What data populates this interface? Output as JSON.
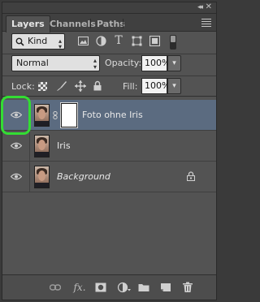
{
  "tabs": [
    {
      "label": "Layers",
      "active": true
    },
    {
      "label": "Channels",
      "active": false
    },
    {
      "label": "Paths",
      "active": false
    }
  ],
  "filter": {
    "kind_label": "Kind"
  },
  "blend": {
    "mode": "Normal",
    "opacity_label": "Opacity:",
    "opacity_value": "100%",
    "lock_label": "Lock:",
    "fill_label": "Fill:",
    "fill_value": "100%"
  },
  "layers": [
    {
      "name": "Foto ohne Iris",
      "visible": true,
      "selected": true,
      "has_mask": true
    },
    {
      "name": "Iris",
      "visible": true,
      "selected": false,
      "has_mask": false
    },
    {
      "name": "Background",
      "visible": true,
      "selected": false,
      "italic": true,
      "locked": true
    }
  ],
  "bottom": {
    "fx_label": "fx."
  },
  "colors": {
    "panel": "#535353",
    "selection": "#5b6b80",
    "highlight": "#33dd33"
  },
  "icons": [
    "collapse-icon",
    "close-icon",
    "panel-menu-icon",
    "search-icon",
    "image-filter-icon",
    "adjustment-filter-icon",
    "type-filter-icon",
    "shape-filter-icon",
    "smart-object-filter-icon",
    "filter-toggle-icon",
    "lock-transparent-icon",
    "lock-image-icon",
    "lock-position-icon",
    "lock-all-icon",
    "eye-icon",
    "link-icon",
    "lock-icon",
    "link-layers-icon",
    "add-mask-icon",
    "new-adjustment-icon",
    "new-group-icon",
    "new-layer-icon",
    "trash-icon"
  ]
}
